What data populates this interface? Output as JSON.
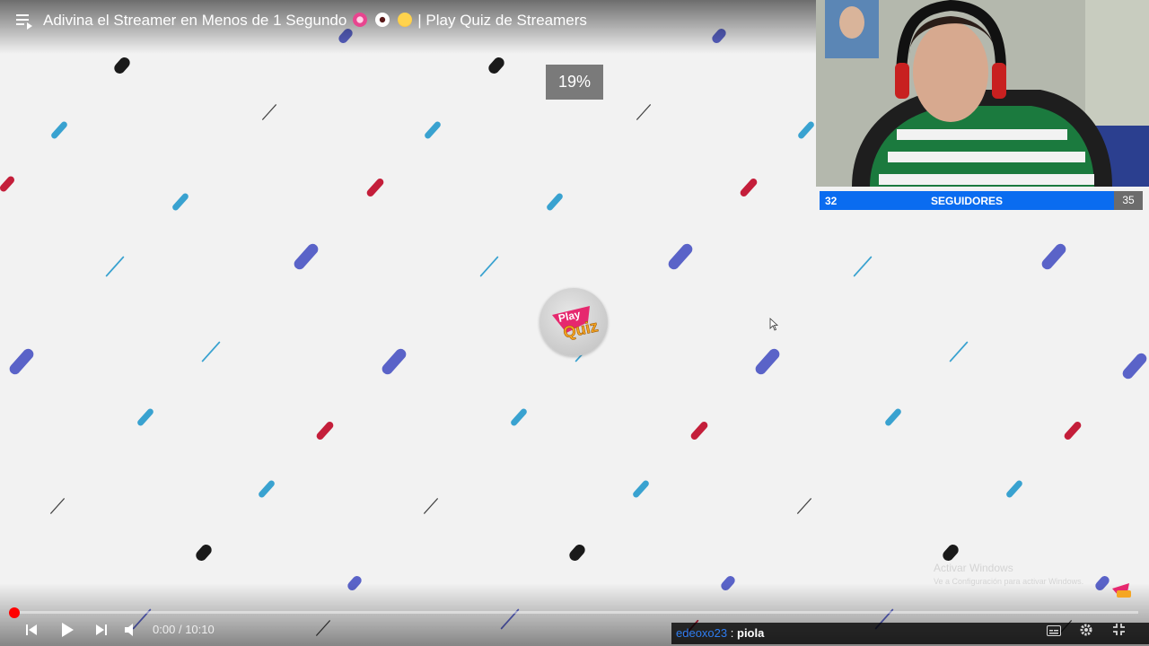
{
  "player": {
    "title": "Adivina el Streamer en Menos de 1 Segundo",
    "title_suffix": "| Play Quiz de Streamers",
    "progress_badge": "19%",
    "time_current": "0:00",
    "time_separator": "/",
    "time_total": "10:10",
    "progress_fraction": 0.0
  },
  "stream_overlay": {
    "followers_current": "32",
    "followers_label": "SEGUIDORES",
    "followers_goal": "35"
  },
  "chat": {
    "username": "edeoxo23",
    "separator": ":",
    "message": "piola"
  },
  "watermark": {
    "line1": "Activar Windows",
    "line2": "Ve a Configuración para activar Windows."
  },
  "logo": {
    "line1": "Play",
    "line2": "Quiz"
  },
  "icons": {
    "playlist": "playlist-icon",
    "prev": "skip-previous-icon",
    "play": "play-icon",
    "next": "skip-next-icon",
    "volume": "volume-icon",
    "subtitles": "subtitles-icon",
    "settings": "gear-icon",
    "fullscreen": "fullscreen-exit-icon"
  },
  "colors": {
    "accent_red": "#ff0000",
    "follower_bar": "#0a6cf0",
    "chat_user": "#2f7df0"
  }
}
